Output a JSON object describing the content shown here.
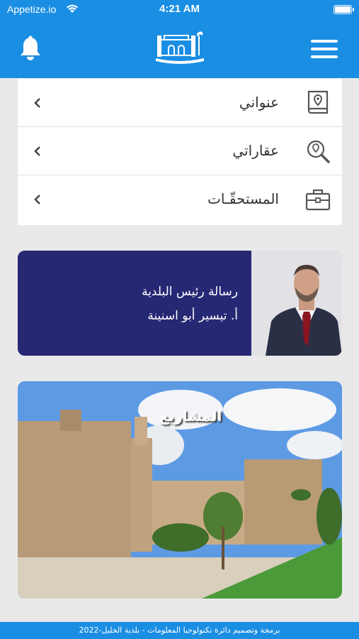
{
  "status_bar": {
    "carrier": "Appetize.io",
    "time": "4:21 AM"
  },
  "header": {
    "bell_icon": "bell-icon",
    "logo": "municipality-logo",
    "menu_icon": "hamburger-menu-icon",
    "accent": "#1a8ee3"
  },
  "menu_items": [
    {
      "label": "عنواني",
      "icon": "location-book-icon"
    },
    {
      "label": "عقاراتي",
      "icon": "property-search-icon"
    },
    {
      "label": "المستحقّـات",
      "icon": "briefcase-icon"
    }
  ],
  "mayor_card": {
    "title": "رسالة رئيس البلدية",
    "name": "أ. تيسير أبو اسنينة",
    "background": "#272874"
  },
  "projects_card": {
    "title": "المشاريع"
  },
  "footer": {
    "text": "برمجة وتصميم دائرة تكنولوجيا المعلومات - بلدية الخليل-2022"
  }
}
